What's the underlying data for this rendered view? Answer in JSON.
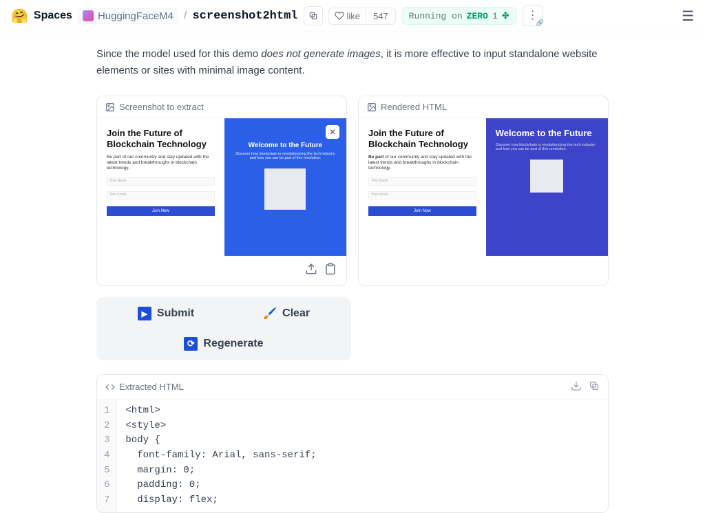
{
  "topbar": {
    "spaces": "Spaces",
    "org": "HuggingFaceM4",
    "slash": "/",
    "repo": "screenshot2html",
    "like_label": "like",
    "like_count": "547",
    "running_on": "Running on",
    "zero": "ZERO",
    "instance_count": "1"
  },
  "intro": {
    "prefix": "Since the model used for this demo ",
    "ital": "does not generate images",
    "suffix": ", it is more effective to input standalone website elements or sites with minimal image content."
  },
  "panels": {
    "left_label": "Screenshot to extract",
    "right_label": "Rendered HTML"
  },
  "mock_left": {
    "title": "Join the Future of Blockchain Technology",
    "sub": "Be part of our community and stay updated with the latest trends and breakthroughs in blockchain technology.",
    "name_ph": "Your Name",
    "email_ph": "Your Email",
    "btn": "Join Now"
  },
  "mock_right_a": {
    "title": "Welcome to the Future",
    "sub": "Discover how blockchain is revolutionizing the tech industry and how you can be part of this revolution."
  },
  "mock_right_b": {
    "title": "Welcome to the Future",
    "sub": "Discover how blockchain is revolutionizing the tech industry and how you can be part of this revolution."
  },
  "actions": {
    "submit": "Submit",
    "clear": "Clear",
    "regenerate": "Regenerate"
  },
  "code_panel": {
    "label": "Extracted HTML",
    "lines": [
      "<html>",
      "<style>",
      "body {",
      "  font-family: Arial, sans-serif;",
      "  margin: 0;",
      "  padding: 0;",
      "  display: flex;"
    ]
  }
}
